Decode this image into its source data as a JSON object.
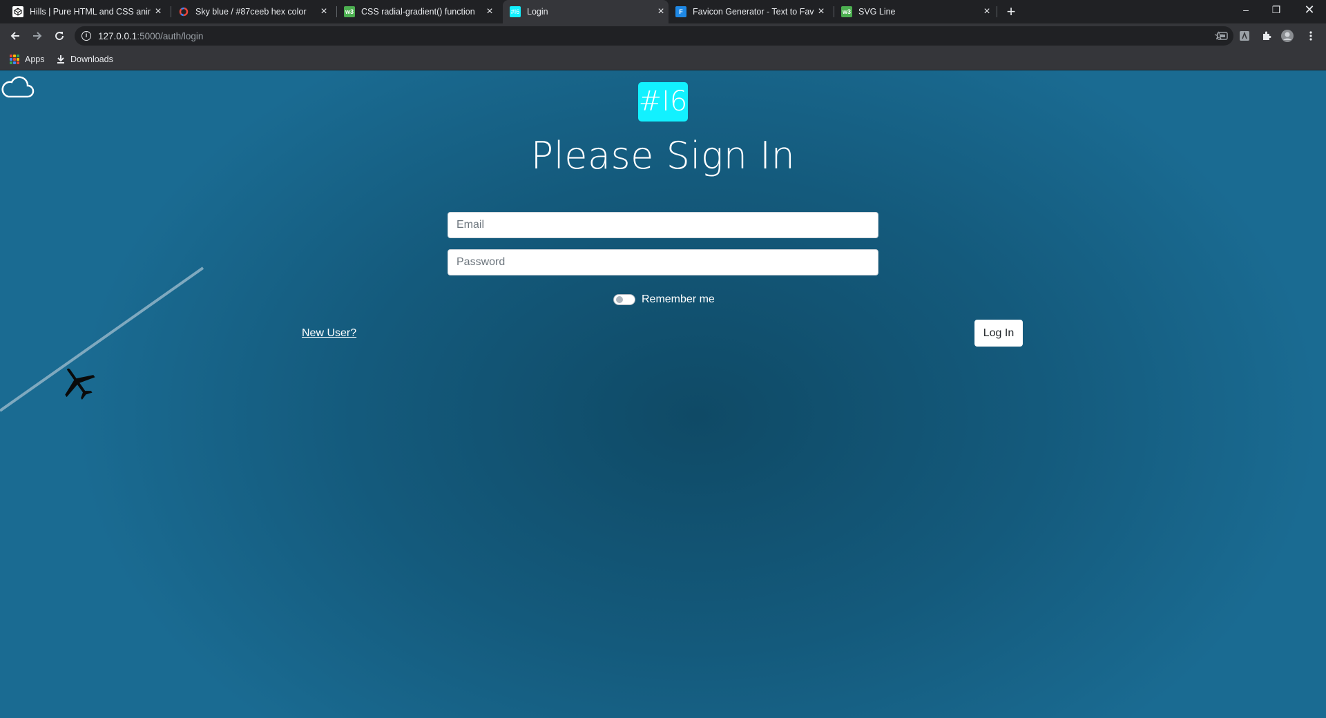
{
  "browser": {
    "tabs": [
      {
        "title": "Hills | Pure HTML and CSS anima",
        "favicon": "codepen-icon",
        "active": false
      },
      {
        "title": "Sky blue / #87ceeb hex color",
        "favicon": "colorhexa-icon",
        "active": false
      },
      {
        "title": "CSS radial-gradient() function",
        "favicon": "w3schools-icon",
        "active": false
      },
      {
        "title": "Login",
        "favicon": "site-favicon",
        "active": true
      },
      {
        "title": "Favicon Generator - Text to Favic",
        "favicon": "favicon-io-icon",
        "active": false
      },
      {
        "title": "SVG Line",
        "favicon": "w3schools-icon",
        "active": false
      }
    ],
    "address": {
      "host": "127.0.0.1",
      "rest": ":5000/auth/login"
    },
    "bookmarks": [
      {
        "label": "Apps",
        "icon": "apps-grid-icon"
      },
      {
        "label": "Downloads",
        "icon": "download-icon"
      }
    ]
  },
  "page": {
    "logo_text": "#I6",
    "heading": "Please Sign In",
    "email_placeholder": "Email",
    "password_placeholder": "Password",
    "remember_label": "Remember me",
    "remember_checked": false,
    "new_user_link": "New User?",
    "login_button": "Log In"
  },
  "colors": {
    "logo_bg": "#12f1ff",
    "page_bg_center": "#0f4a66",
    "page_bg_edge": "#1a6b92",
    "chrome_dark": "#202124",
    "chrome_toolbar": "#35363a"
  }
}
